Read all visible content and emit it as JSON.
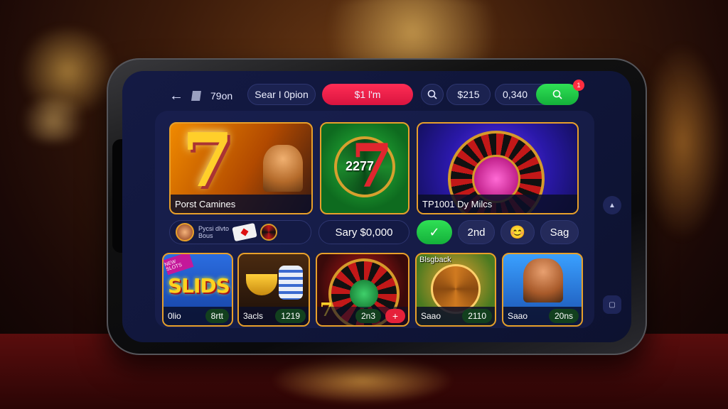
{
  "topbar": {
    "title": "79on",
    "search_option": "Sear I 0pion",
    "promo_button": "$1 l'm",
    "balance_1": "$215",
    "balance_2": "0,340",
    "notification_count": "1"
  },
  "featured": [
    {
      "label": "Porst Camines",
      "number": "",
      "accent": "#f08a00"
    },
    {
      "label": "",
      "number": "2277",
      "accent": "#1c8a2c"
    },
    {
      "label": "TP1001 Dy  Milcs",
      "number": "",
      "accent": "#6a35ff"
    }
  ],
  "middle": {
    "games_line1": "Pycsi dlvto",
    "games_line2": "Bous",
    "say_label": "Sary $0,000",
    "second_label": "2nd",
    "sag_label": "Sag"
  },
  "bottom_cards": [
    {
      "title": "SLIDS",
      "label": "0lio",
      "tag": "8rtt",
      "badge": "NEW SLOTS"
    },
    {
      "title": "",
      "label": "3acls",
      "tag": "1219",
      "badge": ""
    },
    {
      "title": "",
      "label": "",
      "tag": "2n3",
      "badge": ""
    },
    {
      "title": "Blsgback",
      "label": "Saao",
      "tag": "2110",
      "badge": ""
    },
    {
      "title": "",
      "label": "Saao",
      "tag": "20ns",
      "badge": ""
    }
  ],
  "icons": {
    "back": "arrow-left",
    "search": "magnifier",
    "scroll_up": "triangle-up",
    "copy": "document"
  },
  "colors": {
    "accent_red": "#ff2d55",
    "accent_green": "#2fe055",
    "gold_border": "#e8a02a",
    "screen_bg": "#141a44"
  }
}
